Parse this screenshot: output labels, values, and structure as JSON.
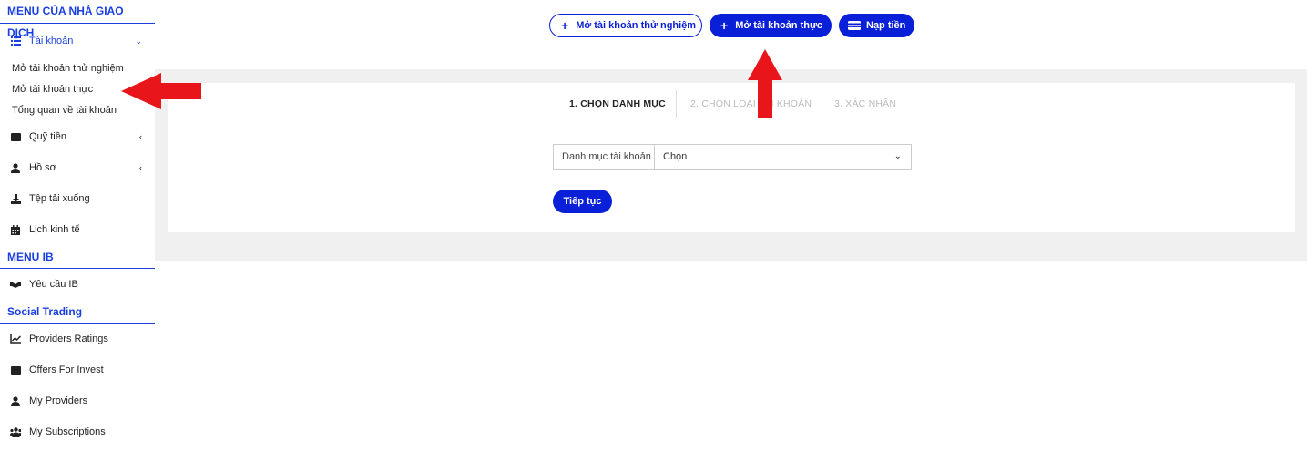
{
  "sidebar": {
    "trader_menu_title": "MENU CỦA NHÀ GIAO DỊCH",
    "account": {
      "label": "Tài khoản",
      "sub_items": [
        "Mở tài khoản thử nghiệm",
        "Mở tài khoản thực",
        "Tổng quan về tài khoản"
      ]
    },
    "funds": "Quỹ tiền",
    "profile": "Hồ sơ",
    "downloads": "Tệp tải xuống",
    "calendar": "Lịch kinh tế",
    "ib_menu_title": "MENU IB",
    "ib_request": "Yêu cầu IB",
    "social_title": "Social Trading",
    "providers_ratings": "Providers Ratings",
    "offers_for_invest": "Offers For Invest",
    "my_providers": "My Providers",
    "my_subscriptions": "My Subscriptions"
  },
  "top_buttons": {
    "demo": "Mở tài khoản thử nghiệm",
    "real": "Mở tài khoản thực",
    "deposit": "Nạp tiền"
  },
  "steps": [
    "1. CHỌN DANH MỤC",
    "2. CHỌN LOẠI TÀI KHOẢN",
    "3. XÁC NHẬN"
  ],
  "form": {
    "category_label": "Danh mục tài khoản",
    "category_value": "Chọn",
    "continue": "Tiếp tục"
  },
  "colors": {
    "accent": "#0a1fd8",
    "annotation_arrow": "#e8161b"
  }
}
